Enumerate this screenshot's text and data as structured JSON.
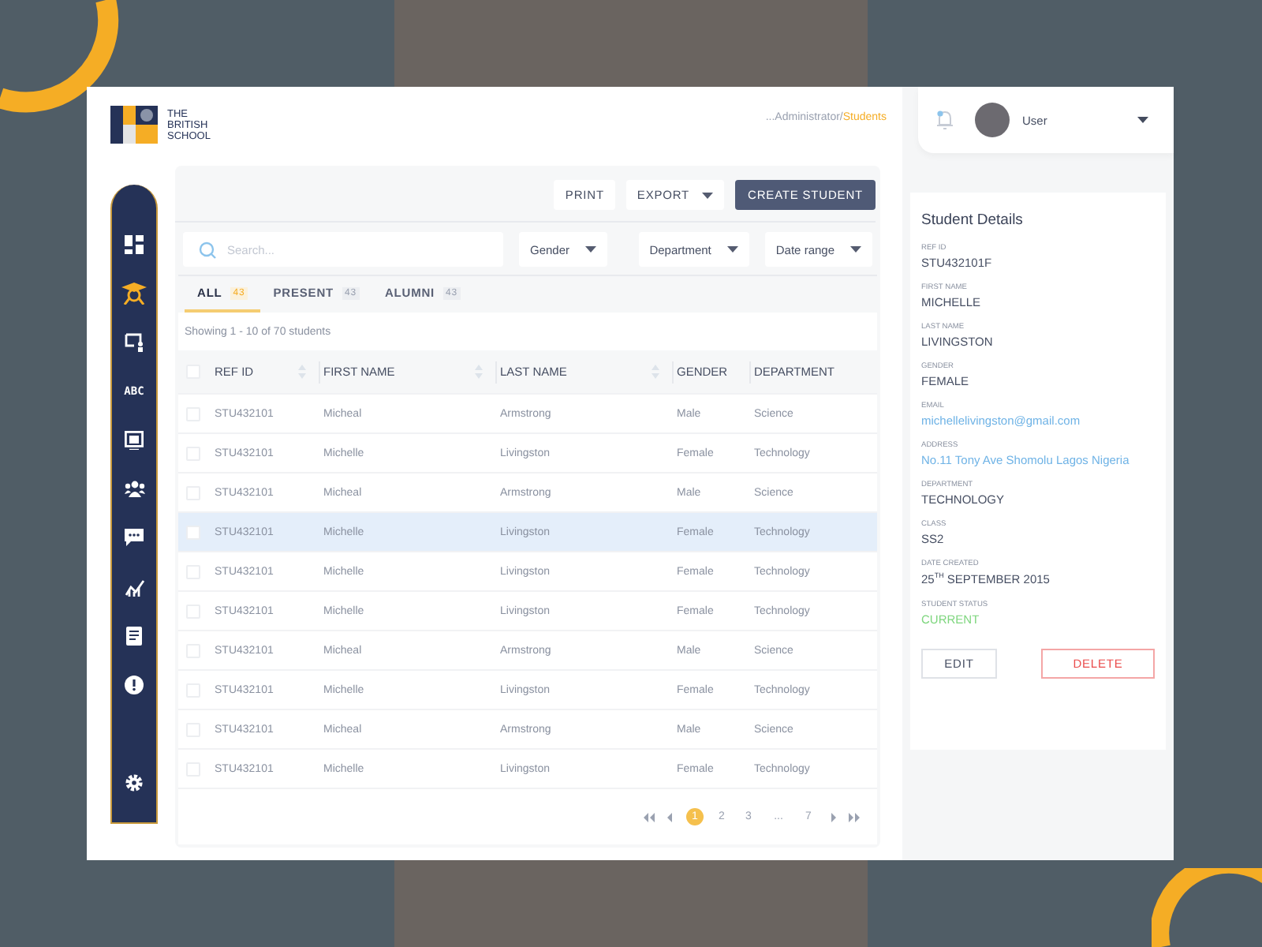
{
  "logo": {
    "text": "THE BRITISH SCHOOL"
  },
  "breadcrumb": {
    "path": "...Administrator/",
    "current": "Students"
  },
  "sidebar": {
    "items": [
      {
        "kind": "dashboard",
        "selected": false
      },
      {
        "kind": "graduate",
        "selected": true
      },
      {
        "kind": "teacher",
        "selected": false
      },
      {
        "kind": "text",
        "label": "ABC",
        "selected": false
      },
      {
        "kind": "board",
        "selected": false
      },
      {
        "kind": "people",
        "selected": false
      },
      {
        "kind": "chat",
        "selected": false
      },
      {
        "kind": "chart",
        "selected": false
      },
      {
        "kind": "document",
        "selected": false
      },
      {
        "kind": "alert",
        "selected": false
      },
      {
        "kind": "settings",
        "selected": false
      }
    ]
  },
  "toolbar": {
    "buttons": [
      {
        "label": "PRINT",
        "kind": "plain"
      },
      {
        "label": "EXPORT",
        "kind": "dropdown"
      },
      {
        "label": "CREATE STUDENT",
        "kind": "primary"
      }
    ]
  },
  "filters": {
    "search": {
      "placeholder": "Search..."
    },
    "dropdowns": [
      "Gender",
      "Department",
      "Date range"
    ]
  },
  "tabs": [
    {
      "label": "ALL",
      "count": "43",
      "selected": true
    },
    {
      "label": "PRESENT",
      "count": "43",
      "selected": false
    },
    {
      "label": "ALUMNI",
      "count": "43",
      "selected": false
    }
  ],
  "summary": "Showing 1 - 10 of 70 students",
  "table": {
    "all_checked": false,
    "columns": [
      {
        "label": "REF ID",
        "sortable": true
      },
      {
        "label": "FIRST NAME",
        "sortable": true
      },
      {
        "label": "LAST NAME",
        "sortable": true
      },
      {
        "label": "GENDER",
        "sortable": false
      },
      {
        "label": "DEPARTMENT",
        "sortable": false
      }
    ],
    "rows": [
      {
        "cells": [
          "STU432101",
          "Micheal",
          "Armstrong",
          "Male",
          "Science"
        ],
        "checked": false,
        "selected": false
      },
      {
        "cells": [
          "STU432101",
          "Michelle",
          "Livingston",
          "Female",
          "Technology"
        ],
        "checked": false,
        "selected": false
      },
      {
        "cells": [
          "STU432101",
          "Micheal",
          "Armstrong",
          "Male",
          "Science"
        ],
        "checked": false,
        "selected": false
      },
      {
        "cells": [
          "STU432101",
          "Michelle",
          "Livingston",
          "Female",
          "Technology"
        ],
        "checked": false,
        "selected": true
      },
      {
        "cells": [
          "STU432101",
          "Michelle",
          "Livingston",
          "Female",
          "Technology"
        ],
        "checked": false,
        "selected": false
      },
      {
        "cells": [
          "STU432101",
          "Michelle",
          "Livingston",
          "Female",
          "Technology"
        ],
        "checked": false,
        "selected": false
      },
      {
        "cells": [
          "STU432101",
          "Micheal",
          "Armstrong",
          "Male",
          "Science"
        ],
        "checked": false,
        "selected": false
      },
      {
        "cells": [
          "STU432101",
          "Michelle",
          "Livingston",
          "Female",
          "Technology"
        ],
        "checked": false,
        "selected": false
      },
      {
        "cells": [
          "STU432101",
          "Micheal",
          "Armstrong",
          "Male",
          "Science"
        ],
        "checked": false,
        "selected": false
      },
      {
        "cells": [
          "STU432101",
          "Michelle",
          "Livingston",
          "Female",
          "Technology"
        ],
        "checked": false,
        "selected": false
      }
    ]
  },
  "pagination": [
    {
      "kind": "first"
    },
    {
      "kind": "prev"
    },
    {
      "kind": "page",
      "label": "1",
      "selected": true
    },
    {
      "kind": "page",
      "label": "2",
      "selected": false
    },
    {
      "kind": "page",
      "label": "3",
      "selected": false
    },
    {
      "kind": "ellipsis",
      "label": "..."
    },
    {
      "kind": "page",
      "label": "7",
      "selected": false
    },
    {
      "kind": "next"
    },
    {
      "kind": "last"
    }
  ],
  "user": {
    "name": "User"
  },
  "details": {
    "title": "Student Details",
    "fields": [
      {
        "label": "REF ID",
        "value": "STU432101F",
        "kind": "text"
      },
      {
        "label": "FIRST NAME",
        "value": "MICHELLE",
        "kind": "text"
      },
      {
        "label": "LAST NAME",
        "value": "LIVINGSTON",
        "kind": "text"
      },
      {
        "label": "GENDER",
        "value": "FEMALE",
        "kind": "text"
      },
      {
        "label": "EMAIL",
        "value": "michellelivingston@gmail.com",
        "kind": "link"
      },
      {
        "label": "ADDRESS",
        "value": "No.11 Tony Ave Shomolu Lagos Nigeria",
        "kind": "link"
      },
      {
        "label": "DEPARTMENT",
        "value": "TECHNOLOGY",
        "kind": "text"
      },
      {
        "label": "CLASS",
        "value": "SS2",
        "kind": "text"
      },
      {
        "label": "DATE CREATED",
        "value": "25$^{TH}$ SEPTEMBER 2015",
        "kind": "text"
      },
      {
        "label": "STUDENT STATUS",
        "value": "CURRENT",
        "kind": "status"
      }
    ],
    "buttons": [
      {
        "label": "EDIT",
        "kind": "plain"
      },
      {
        "label": "DELETE",
        "kind": "danger"
      }
    ]
  }
}
